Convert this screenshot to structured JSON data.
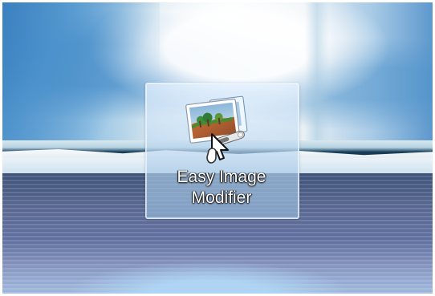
{
  "desktop": {
    "icon": {
      "label_line_1": "Easy Image",
      "label_line_2": "Modifier",
      "icon_name": "easy-image-modifier-icon",
      "selected": true
    },
    "pointer": {
      "icon_name": "hand-pointer-cursor-icon"
    }
  },
  "colors": {
    "selection_fill": "#b7d4ee",
    "selection_border": "#ddecfa",
    "label_text": "#ffffff",
    "sea": "#5f6d98",
    "ice": "#e8f0f4"
  }
}
